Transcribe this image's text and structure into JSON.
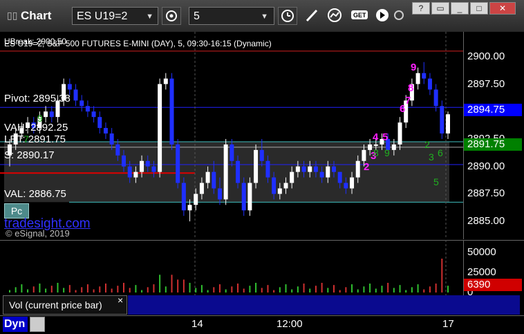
{
  "window": {
    "title": "Chart",
    "symbol": "ES U19=2",
    "interval": "5",
    "buttons": [
      "minimize",
      "restore",
      "maximize",
      "close"
    ]
  },
  "header": {
    "study_line": "ES U19=2, S&P 500 FUTURES E-MINI (DAY), 5, 09:30-16:15 (Dynamic)",
    "ubreak_label": "UBreak: 2900.50"
  },
  "levels": {
    "pivot": "Pivot: 2895.38",
    "vah": "VAH: 2892.25",
    "lrt": "LRT: 2891.75",
    "s": "S: 2890.17",
    "val": "VAL: 2886.75"
  },
  "price_axis": {
    "ticks": [
      "2900.00",
      "2897.50",
      "2895.00",
      "2892.50",
      "2890.00",
      "2887.50",
      "2885.00"
    ],
    "last_price": "2894.75",
    "last_price_color": "#0000ff",
    "level_price": "2891.75",
    "level_price_color": "#008000"
  },
  "volume": {
    "legend": "Vol (current price bar)",
    "close_icon": "×",
    "ticks": [
      "50000",
      "25000",
      "0"
    ],
    "last_volume": "6390",
    "last_volume_color": "#d00000"
  },
  "time_axis": {
    "labels": [
      "14",
      "12:00",
      "17"
    ],
    "dyn_label": "Dyn"
  },
  "watermark": "tradesight.com",
  "copyright": "© eSignal, 2019",
  "pc_button": "Pc",
  "td_counts_magenta": [
    "9",
    "8",
    "7",
    "6",
    "4",
    "5",
    "3",
    "2"
  ],
  "td_counts_green": [
    "9",
    "7",
    "8",
    "9",
    "2",
    "3",
    "6",
    "5"
  ],
  "chart_data": {
    "type": "candlestick",
    "symbol": "ES U19=2",
    "ylim": [
      2884.0,
      2901.5
    ],
    "bars": [
      [
        2891.0,
        2892.5,
        2890.0,
        2892.0
      ],
      [
        2892.0,
        2893.5,
        2891.5,
        2893.0
      ],
      [
        2893.0,
        2894.0,
        2892.5,
        2893.5
      ],
      [
        2893.5,
        2894.5,
        2893.0,
        2894.0
      ],
      [
        2894.0,
        2894.5,
        2893.0,
        2893.5
      ],
      [
        2893.5,
        2895.0,
        2893.0,
        2894.5
      ],
      [
        2894.5,
        2895.5,
        2894.0,
        2895.0
      ],
      [
        2895.0,
        2895.5,
        2894.0,
        2894.5
      ],
      [
        2894.5,
        2896.5,
        2894.0,
        2896.0
      ],
      [
        2896.0,
        2898.0,
        2895.5,
        2897.5
      ],
      [
        2897.5,
        2898.0,
        2896.5,
        2897.0
      ],
      [
        2897.0,
        2897.5,
        2895.5,
        2896.0
      ],
      [
        2896.0,
        2896.5,
        2895.0,
        2895.5
      ],
      [
        2895.5,
        2896.0,
        2894.5,
        2895.0
      ],
      [
        2895.0,
        2895.5,
        2894.0,
        2894.5
      ],
      [
        2894.5,
        2895.0,
        2893.0,
        2893.5
      ],
      [
        2893.5,
        2894.0,
        2892.5,
        2893.0
      ],
      [
        2893.0,
        2893.5,
        2891.5,
        2892.0
      ],
      [
        2892.0,
        2892.5,
        2890.5,
        2891.0
      ],
      [
        2891.0,
        2891.5,
        2889.5,
        2890.0
      ],
      [
        2890.0,
        2890.5,
        2888.5,
        2889.0
      ],
      [
        2889.0,
        2890.0,
        2888.5,
        2889.5
      ],
      [
        2889.5,
        2891.0,
        2889.0,
        2890.5
      ],
      [
        2890.5,
        2891.0,
        2889.5,
        2890.0
      ],
      [
        2890.0,
        2890.5,
        2889.0,
        2889.5
      ],
      [
        2889.5,
        2898.0,
        2889.0,
        2897.5
      ],
      [
        2897.5,
        2898.5,
        2897.0,
        2898.0
      ],
      [
        2898.0,
        2898.5,
        2891.5,
        2892.0
      ],
      [
        2892.0,
        2892.5,
        2888.0,
        2888.5
      ],
      [
        2888.5,
        2889.0,
        2885.5,
        2886.0
      ],
      [
        2886.0,
        2887.0,
        2885.0,
        2886.5
      ],
      [
        2886.5,
        2888.0,
        2886.0,
        2887.5
      ],
      [
        2887.5,
        2889.0,
        2887.0,
        2888.5
      ],
      [
        2888.5,
        2890.0,
        2888.0,
        2889.5
      ],
      [
        2889.5,
        2890.5,
        2887.5,
        2888.0
      ],
      [
        2888.0,
        2889.0,
        2886.5,
        2887.0
      ],
      [
        2887.0,
        2892.5,
        2886.5,
        2892.0
      ],
      [
        2892.0,
        2892.5,
        2890.0,
        2890.5
      ],
      [
        2890.5,
        2891.0,
        2888.0,
        2888.5
      ],
      [
        2888.5,
        2889.0,
        2885.5,
        2886.0
      ],
      [
        2886.0,
        2889.0,
        2885.5,
        2888.5
      ],
      [
        2888.5,
        2892.0,
        2888.0,
        2891.5
      ],
      [
        2891.5,
        2892.5,
        2890.0,
        2890.5
      ],
      [
        2890.5,
        2891.0,
        2888.5,
        2889.0
      ],
      [
        2889.0,
        2889.5,
        2887.0,
        2887.5
      ],
      [
        2887.5,
        2888.5,
        2887.0,
        2888.0
      ],
      [
        2888.0,
        2889.0,
        2887.5,
        2888.5
      ],
      [
        2888.5,
        2890.0,
        2888.0,
        2889.5
      ],
      [
        2889.5,
        2890.5,
        2889.0,
        2890.0
      ],
      [
        2890.0,
        2890.5,
        2889.0,
        2889.5
      ],
      [
        2889.5,
        2890.5,
        2889.0,
        2890.0
      ],
      [
        2890.0,
        2890.5,
        2889.0,
        2889.5
      ],
      [
        2889.5,
        2890.0,
        2888.5,
        2889.0
      ],
      [
        2889.0,
        2890.5,
        2888.5,
        2890.0
      ],
      [
        2890.0,
        2890.5,
        2889.0,
        2889.5
      ],
      [
        2889.5,
        2889.5,
        2888.0,
        2888.5
      ],
      [
        2888.5,
        2889.0,
        2887.5,
        2888.0
      ],
      [
        2888.0,
        2889.5,
        2887.5,
        2889.0
      ],
      [
        2889.0,
        2891.0,
        2888.5,
        2890.5
      ],
      [
        2890.5,
        2892.0,
        2890.0,
        2891.5
      ],
      [
        2891.5,
        2892.5,
        2891.0,
        2892.0
      ],
      [
        2892.0,
        2892.5,
        2891.5,
        2892.0
      ],
      [
        2892.0,
        2893.0,
        2891.5,
        2892.5
      ],
      [
        2892.5,
        2893.0,
        2891.5,
        2891.5
      ],
      [
        2891.5,
        2892.5,
        2891.0,
        2892.0
      ],
      [
        2892.0,
        2894.5,
        2891.5,
        2894.0
      ],
      [
        2894.0,
        2896.5,
        2893.5,
        2896.0
      ],
      [
        2896.0,
        2898.0,
        2895.5,
        2897.5
      ],
      [
        2897.5,
        2899.0,
        2897.0,
        2898.5
      ],
      [
        2898.5,
        2899.5,
        2897.5,
        2898.0
      ],
      [
        2898.0,
        2898.5,
        2896.5,
        2897.0
      ],
      [
        2897.0,
        2897.5,
        2895.0,
        2895.5
      ],
      [
        2895.5,
        2896.0,
        2892.5,
        2893.0
      ],
      [
        2893.0,
        2895.0,
        2892.5,
        2894.75
      ]
    ],
    "volume_ylim": [
      0,
      60000
    ],
    "volume_ticks": [
      50000,
      25000,
      0
    ],
    "last_volume": 6390
  }
}
